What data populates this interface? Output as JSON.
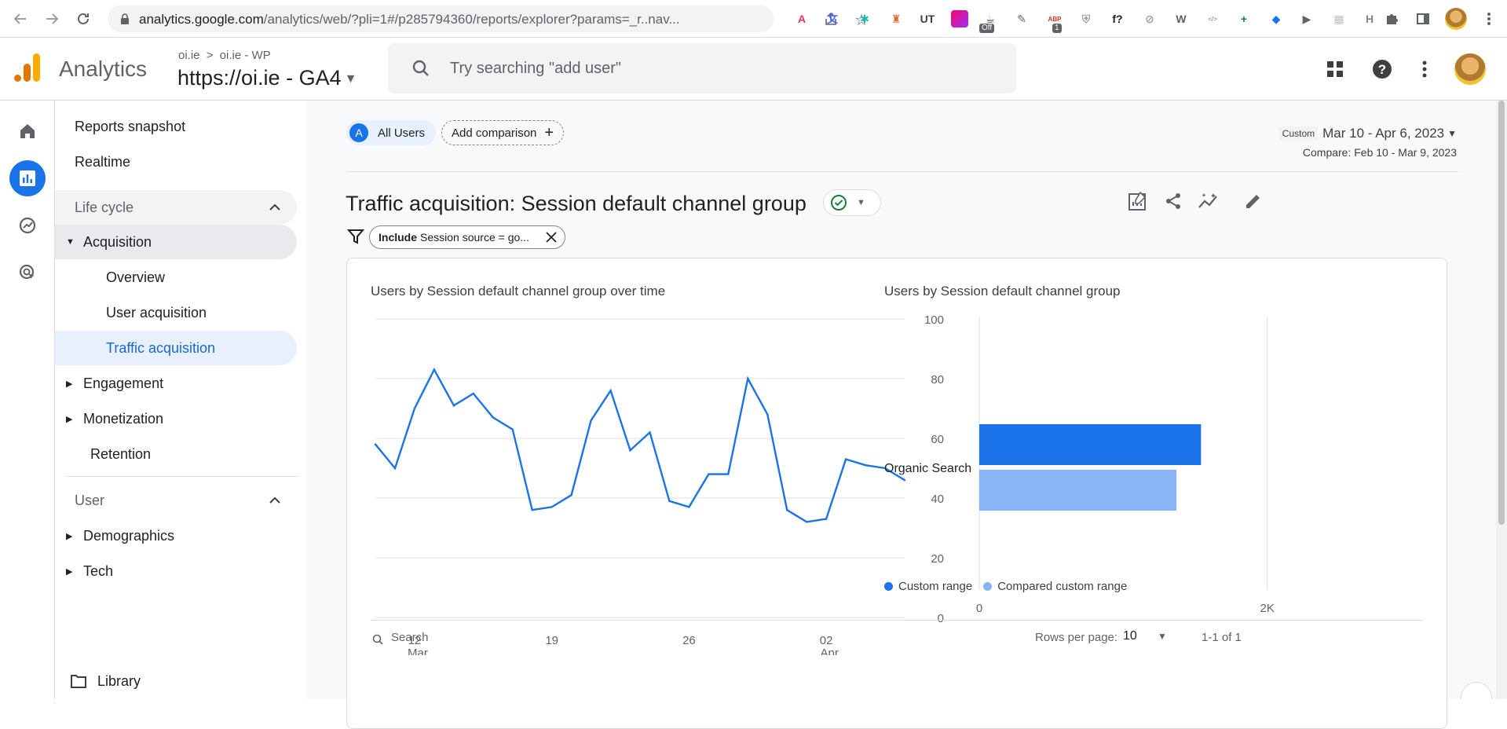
{
  "browser": {
    "url_host": "analytics.google.com",
    "url_path": "/analytics/web/?pli=1#/p285794360/reports/explorer?params=_r..nav...",
    "extensions": [
      {
        "name": "ext-a-icon",
        "text": "A",
        "color": "#e8346b"
      },
      {
        "name": "ext-translate-icon",
        "text": "文",
        "color": "#4a6cf7"
      },
      {
        "name": "ext-asterisk-icon",
        "text": "✱",
        "color": "#1fb8b0"
      },
      {
        "name": "ext-bottle-icon",
        "text": "♜",
        "color": "#f2662b"
      },
      {
        "name": "ext-ut-icon",
        "text": "UT",
        "color": "#3c4043"
      },
      {
        "name": "ext-gradient-icon",
        "text": "",
        "color": "#d946a8"
      },
      {
        "name": "ext-cup-icon",
        "text": "☕",
        "color": "#5f6368"
      },
      {
        "name": "ext-scribble-icon",
        "text": "✎",
        "color": "#5f6368"
      },
      {
        "name": "ext-adblock-icon",
        "text": "ABP",
        "color": "#d32f2f"
      },
      {
        "name": "ext-shield-icon",
        "text": "⛨",
        "color": "#9aa0a6"
      },
      {
        "name": "ext-fx-icon",
        "text": "f?",
        "color": "#202124"
      },
      {
        "name": "ext-compass-icon",
        "text": "⊘",
        "color": "#9aa0a6"
      },
      {
        "name": "ext-wordpress-icon",
        "text": "W",
        "color": "#5f6368"
      },
      {
        "name": "ext-code-icon",
        "text": "</>",
        "color": "#9aa0a6"
      },
      {
        "name": "ext-plus-icon",
        "text": "+",
        "color": "#188038"
      },
      {
        "name": "ext-tag-icon",
        "text": "◆",
        "color": "#1a73e8"
      },
      {
        "name": "ext-cursor-icon",
        "text": "▶",
        "color": "#5f6368"
      },
      {
        "name": "ext-grid-icon",
        "text": "▦",
        "color": "#bdc1c6"
      },
      {
        "name": "ext-h-icon",
        "text": "H",
        "color": "#80868b"
      }
    ],
    "badges": {
      "cup": "Off",
      "adblock": "1"
    }
  },
  "header": {
    "product": "Analytics",
    "breadcrumb_account": "oi.ie",
    "breadcrumb_sep": ">",
    "breadcrumb_property": "oi.ie - WP",
    "property_name": "https://oi.ie - GA4",
    "search_placeholder": "Try searching \"add user\""
  },
  "sidenav": {
    "items": [
      {
        "label": "Reports snapshot"
      },
      {
        "label": "Realtime"
      },
      {
        "label": "Life cycle"
      },
      {
        "label": "Acquisition"
      },
      {
        "label": "Overview"
      },
      {
        "label": "User acquisition"
      },
      {
        "label": "Traffic acquisition"
      },
      {
        "label": "Engagement"
      },
      {
        "label": "Monetization"
      },
      {
        "label": "Retention"
      },
      {
        "label": "User"
      },
      {
        "label": "Demographics"
      },
      {
        "label": "Tech"
      }
    ],
    "library": "Library"
  },
  "toolbar": {
    "segment_letter": "A",
    "segment_label": "All Users",
    "add_comparison": "Add comparison",
    "date_custom": "Custom",
    "date_range": "Mar 10 - Apr 6, 2023",
    "date_compare": "Compare: Feb 10 - Mar 9, 2023"
  },
  "report": {
    "title": "Traffic acquisition: Session default channel group",
    "filter_include": "Include",
    "filter_text": "Session source = go..."
  },
  "card": {
    "line_title": "Users by Session default channel group over time",
    "bar_title": "Users by Session default channel group",
    "legend_custom": "Custom range",
    "legend_compared": "Compared custom range",
    "table_search": "Search",
    "rows_per_page_label": "Rows per page:",
    "rows_per_page_value": "10",
    "pager": "1-1 of 1"
  },
  "colors": {
    "accent": "#1a73e8",
    "series_primary": "#1a73e8",
    "series_compare": "#8ab4f8"
  },
  "chart_data": [
    {
      "type": "line",
      "title": "Users by Session default channel group over time",
      "x": [
        "Mar 10",
        "Mar 11",
        "Mar 12",
        "Mar 13",
        "Mar 14",
        "Mar 15",
        "Mar 16",
        "Mar 17",
        "Mar 18",
        "Mar 19",
        "Mar 20",
        "Mar 21",
        "Mar 22",
        "Mar 23",
        "Mar 24",
        "Mar 25",
        "Mar 26",
        "Mar 27",
        "Mar 28",
        "Mar 29",
        "Mar 30",
        "Mar 31",
        "Apr 1",
        "Apr 2",
        "Apr 3",
        "Apr 4",
        "Apr 5",
        "Apr 6"
      ],
      "series": [
        {
          "values": [
            58,
            50,
            70,
            83,
            71,
            75,
            67,
            63,
            36,
            37,
            41,
            66,
            76,
            56,
            62,
            39,
            37,
            48,
            48,
            80,
            68,
            36,
            32,
            33,
            53,
            51,
            50,
            46
          ]
        }
      ],
      "x_ticks": [
        {
          "at": "Mar 12",
          "day": "12",
          "month": "Mar"
        },
        {
          "at": "Mar 19",
          "day": "19",
          "month": ""
        },
        {
          "at": "Mar 26",
          "day": "26",
          "month": ""
        },
        {
          "at": "Apr 2",
          "day": "02",
          "month": "Apr"
        }
      ],
      "y_ticks": [
        0,
        20,
        40,
        60,
        80,
        100
      ],
      "ylim": [
        0,
        100
      ],
      "grid": true,
      "y_axis_side": "right"
    },
    {
      "type": "bar",
      "orientation": "horizontal",
      "title": "Users by Session default channel group",
      "categories": [
        "Organic Search"
      ],
      "series": [
        {
          "name": "Custom range",
          "values": [
            1540
          ]
        },
        {
          "name": "Compared custom range",
          "values": [
            1370
          ]
        }
      ],
      "x_ticks": [
        "0",
        "2K"
      ],
      "xlim": [
        0,
        2100
      ],
      "legend": "bottom"
    }
  ]
}
